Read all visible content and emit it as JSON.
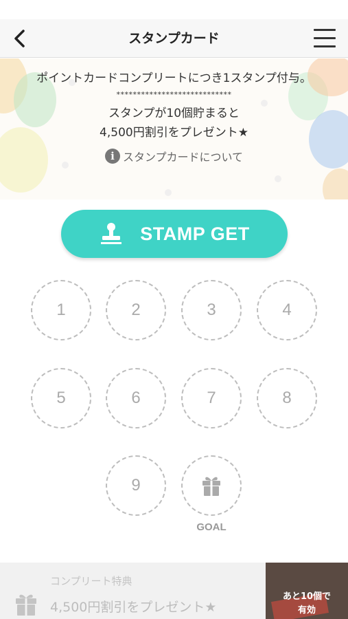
{
  "nav": {
    "title": "スタンプカード"
  },
  "hero": {
    "line1": "ポイントカードコンプリートにつき1スタンプ付与。",
    "separator": "****************************",
    "line2": "スタンプが10個貯まると",
    "line3": "4,500円割引をプレゼント★",
    "info_icon": "i",
    "info_link": "スタンプカードについて"
  },
  "stamp_button": {
    "label": "STAMP GET"
  },
  "stamp_slots": [
    "1",
    "2",
    "3",
    "4",
    "5",
    "6",
    "7",
    "8",
    "9"
  ],
  "goal": {
    "label": "GOAL"
  },
  "bottom": {
    "subtitle": "コンプリート特典",
    "reward": "4,500円割引をプレゼント★",
    "badge_line1": "あと10個で",
    "badge_line2": "有効"
  },
  "colors": {
    "accent": "#3fd3c6",
    "slot_border": "#bdbdbd",
    "slot_text": "#aaaaaa"
  }
}
